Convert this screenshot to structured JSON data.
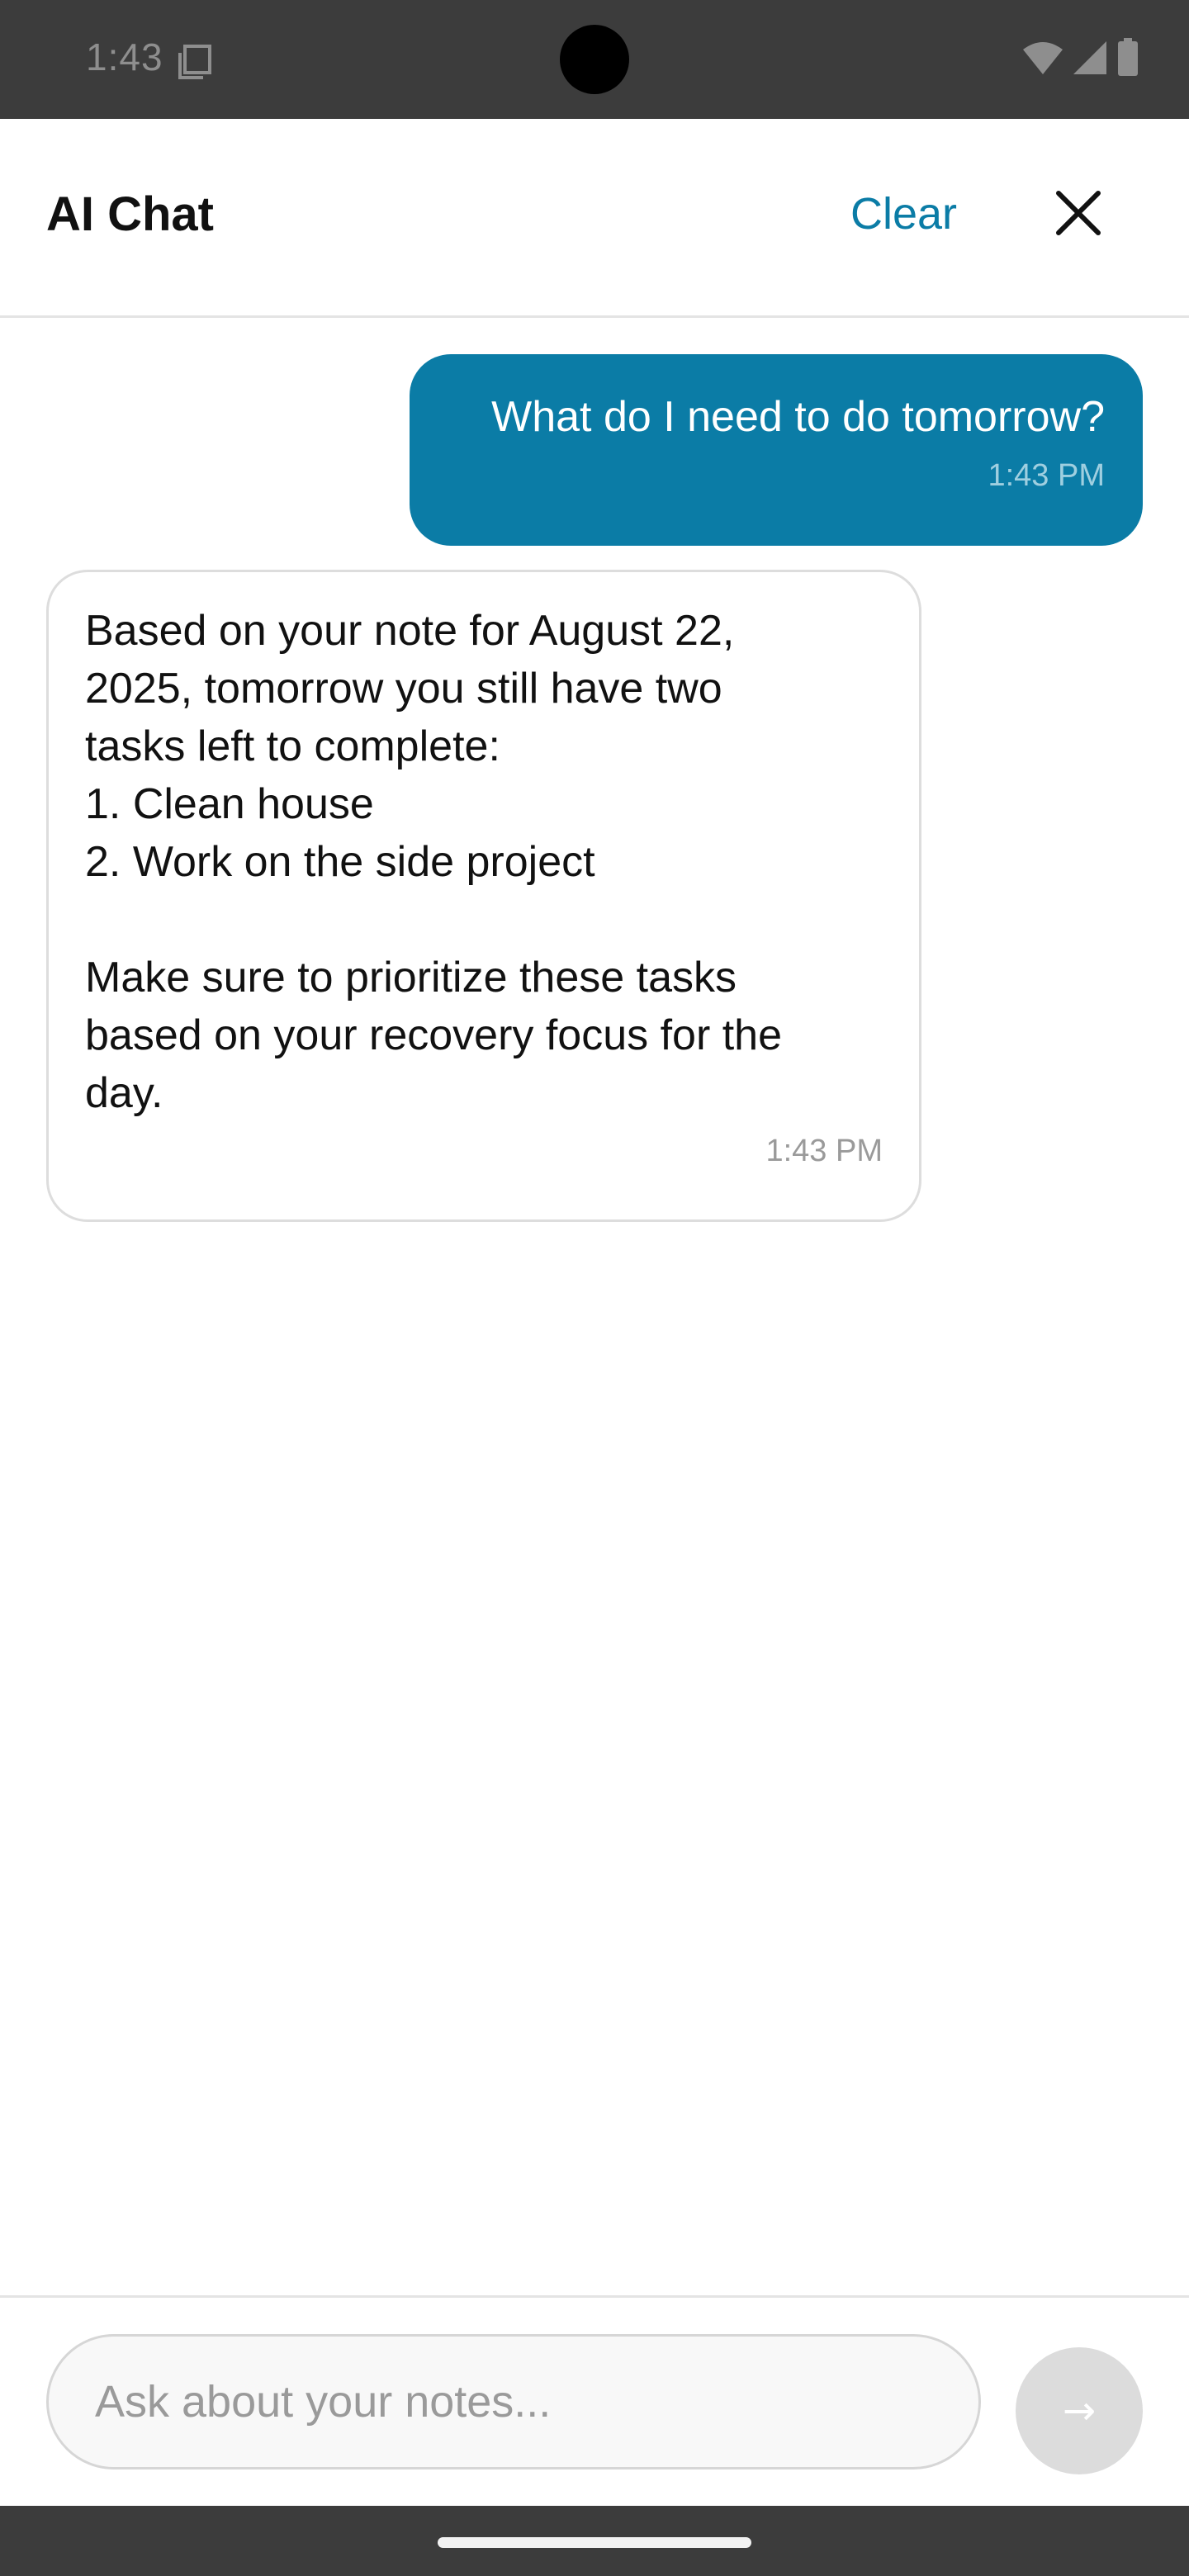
{
  "status_bar": {
    "time": "1:43"
  },
  "header": {
    "title": "AI Chat",
    "clear_label": "Clear"
  },
  "messages": {
    "user": {
      "text": "What do I need to do tomorrow?",
      "time": "1:43 PM"
    },
    "ai": {
      "lines": [
        "Based on your note for August 22,",
        "2025, tomorrow you still have two",
        "tasks left to complete:",
        "1. Clean house",
        "2. Work on the side project",
        "",
        "Make sure to prioritize these tasks",
        "based on your recovery focus for the",
        "day."
      ],
      "time": "1:43 PM"
    }
  },
  "input": {
    "placeholder": "Ask about your notes...",
    "value": ""
  },
  "send_button": {
    "glyph": "→",
    "enabled": false
  },
  "colors": {
    "accent": "#0b7ca6",
    "status_bar": "#3c3c3c",
    "send_disabled": "#dcdcdc"
  },
  "icons": {
    "status_left": "screenshot-icon",
    "status_right": [
      "wifi-icon",
      "cellular-signal-icon",
      "battery-icon"
    ],
    "close": "close-icon",
    "send": "arrow-right-icon"
  }
}
